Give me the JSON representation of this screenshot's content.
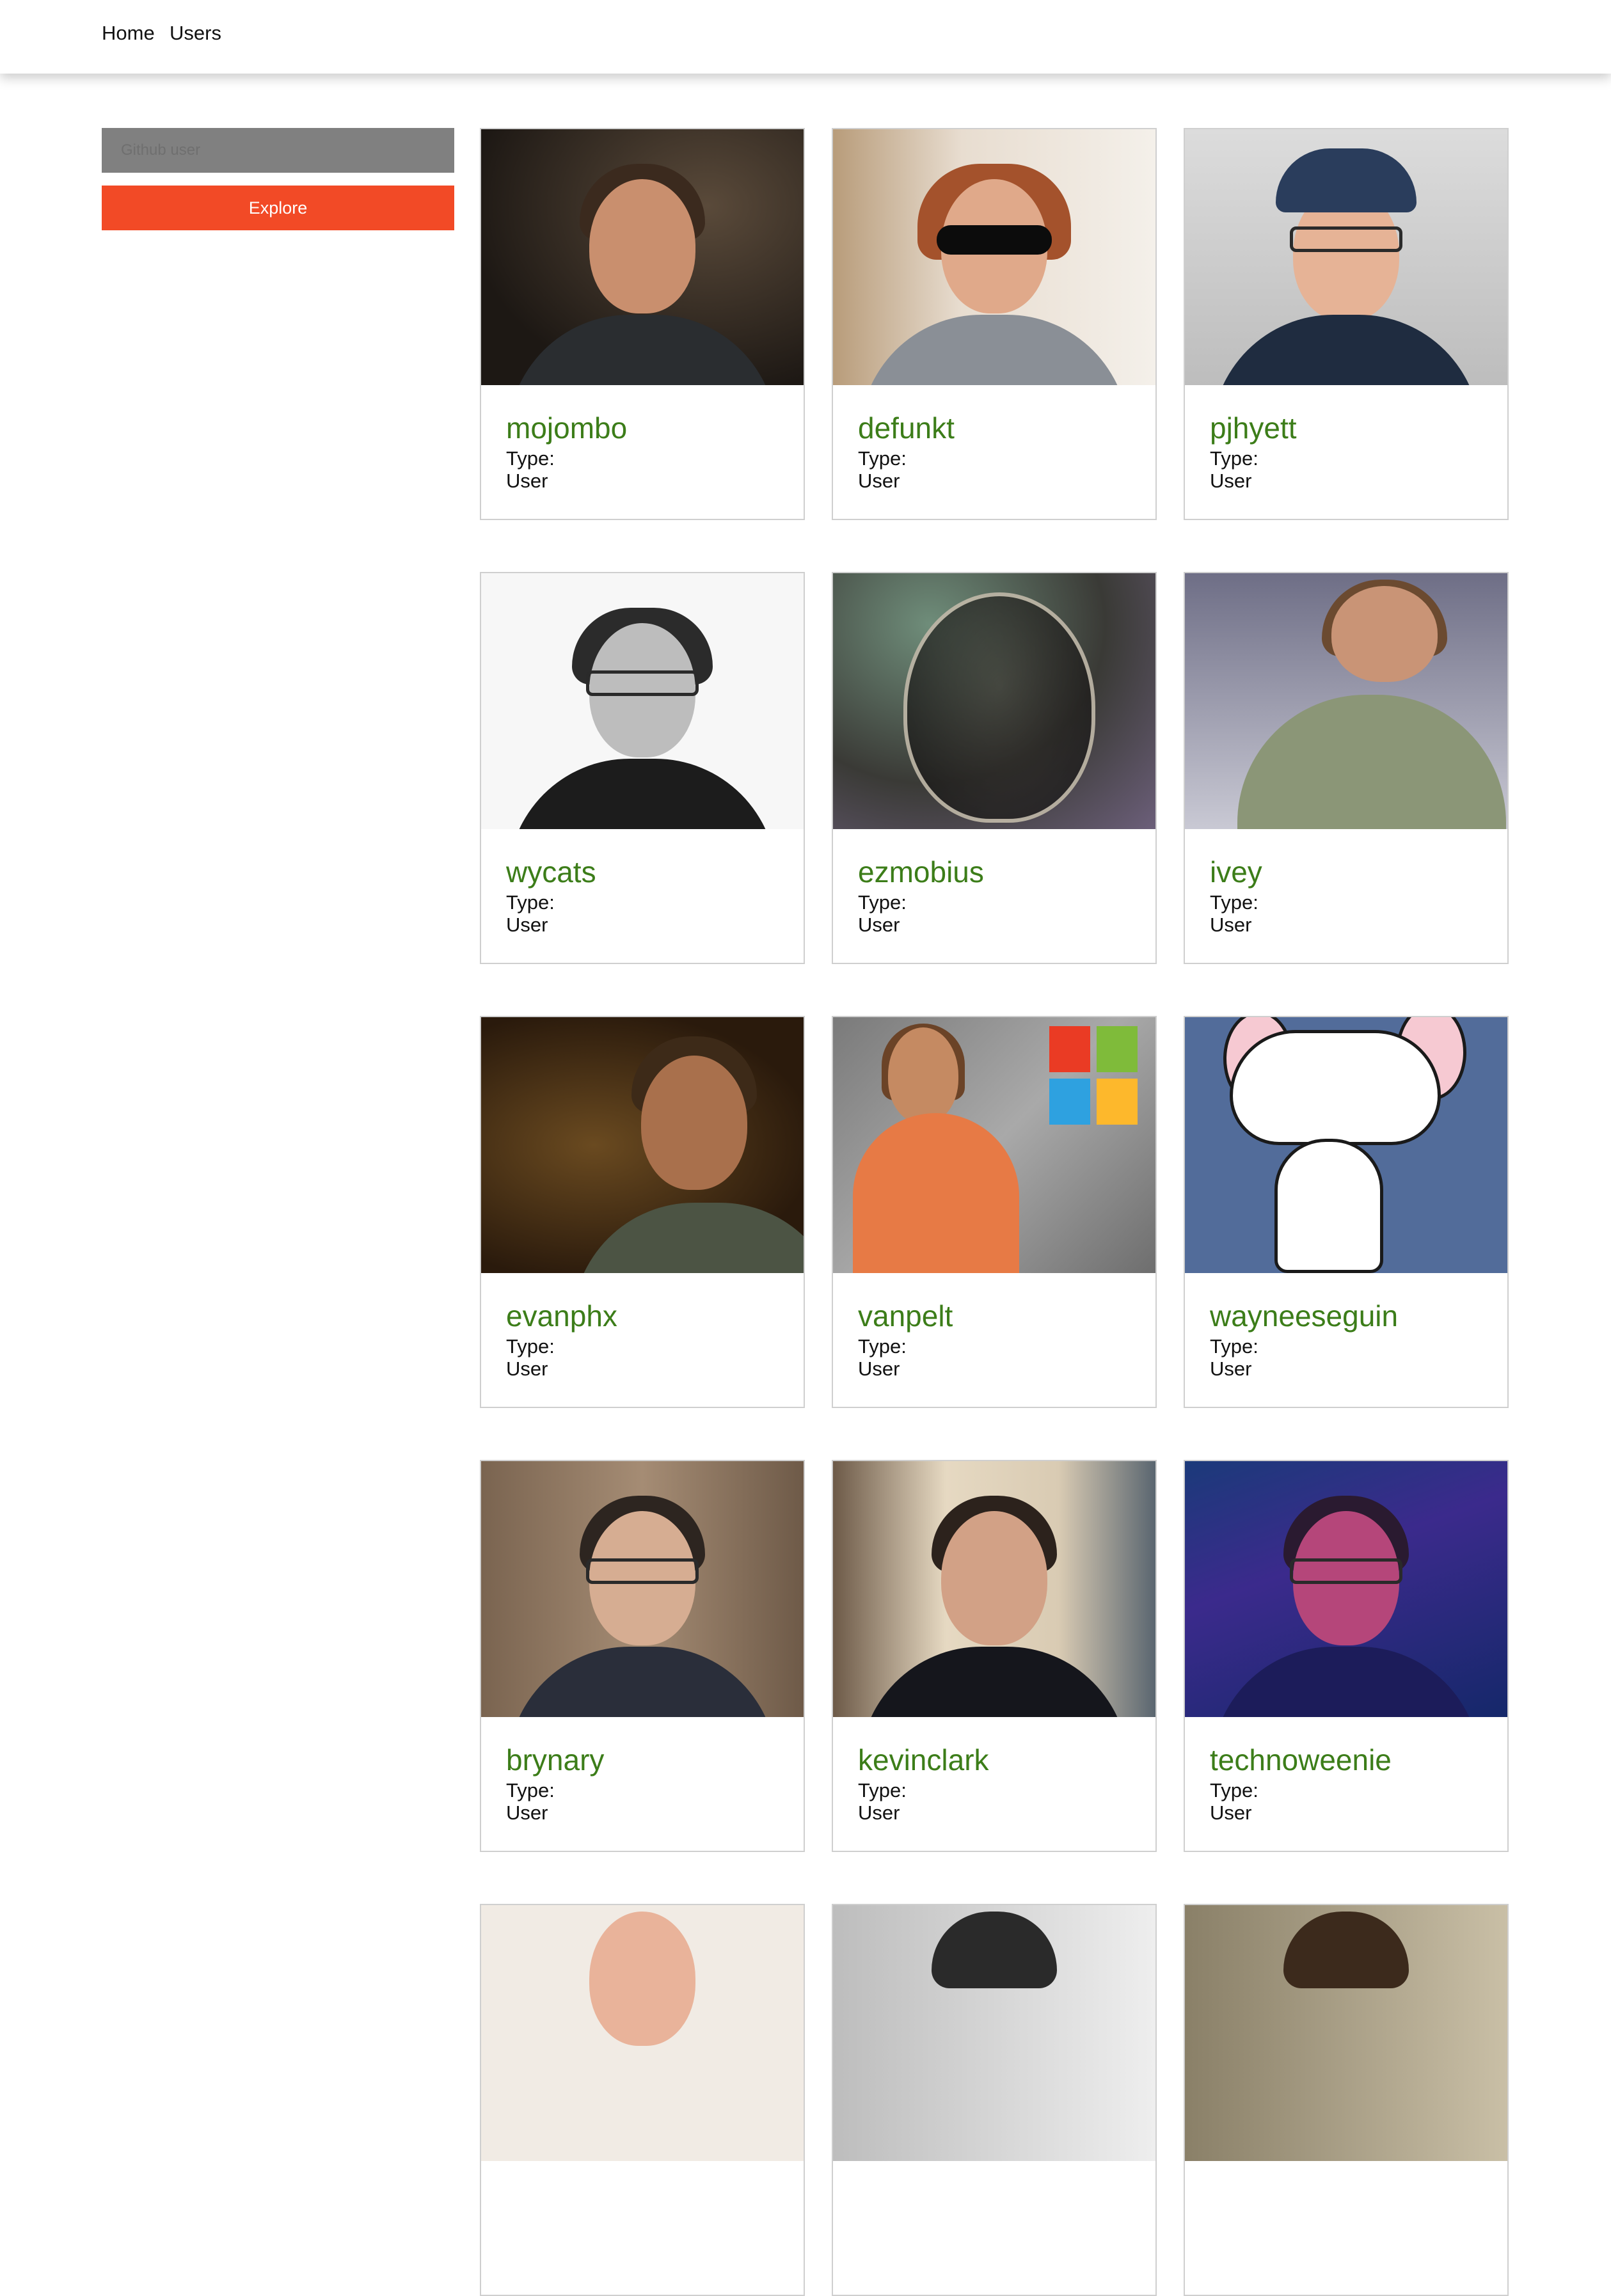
{
  "nav": {
    "home_label": "Home",
    "users_label": "Users"
  },
  "search": {
    "placeholder": "Github user",
    "value": ""
  },
  "explore_label": "Explore",
  "users": [
    {
      "login": "mojombo",
      "type_label": "Type:",
      "type": "User",
      "avatar_icon": "user-avatar-image"
    },
    {
      "login": "defunkt",
      "type_label": "Type:",
      "type": "User",
      "avatar_icon": "user-avatar-image"
    },
    {
      "login": "pjhyett",
      "type_label": "Type:",
      "type": "User",
      "avatar_icon": "user-avatar-image"
    },
    {
      "login": "wycats",
      "type_label": "Type:",
      "type": "User",
      "avatar_icon": "user-avatar-image"
    },
    {
      "login": "ezmobius",
      "type_label": "Type:",
      "type": "User",
      "avatar_icon": "user-avatar-image"
    },
    {
      "login": "ivey",
      "type_label": "Type:",
      "type": "User",
      "avatar_icon": "user-avatar-image"
    },
    {
      "login": "evanphx",
      "type_label": "Type:",
      "type": "User",
      "avatar_icon": "user-avatar-image"
    },
    {
      "login": "vanpelt",
      "type_label": "Type:",
      "type": "User",
      "avatar_icon": "user-avatar-image"
    },
    {
      "login": "wayneeseguin",
      "type_label": "Type:",
      "type": "User",
      "avatar_icon": "user-avatar-image"
    },
    {
      "login": "brynary",
      "type_label": "Type:",
      "type": "User",
      "avatar_icon": "user-avatar-image"
    },
    {
      "login": "kevinclark",
      "type_label": "Type:",
      "type": "User",
      "avatar_icon": "user-avatar-image"
    },
    {
      "login": "technoweenie",
      "type_label": "Type:",
      "type": "User",
      "avatar_icon": "user-avatar-image"
    }
  ],
  "colors": {
    "accent": "#f24a26",
    "username": "#3c7d19",
    "search_bg": "#808080",
    "card_border": "#cfcfcf"
  }
}
